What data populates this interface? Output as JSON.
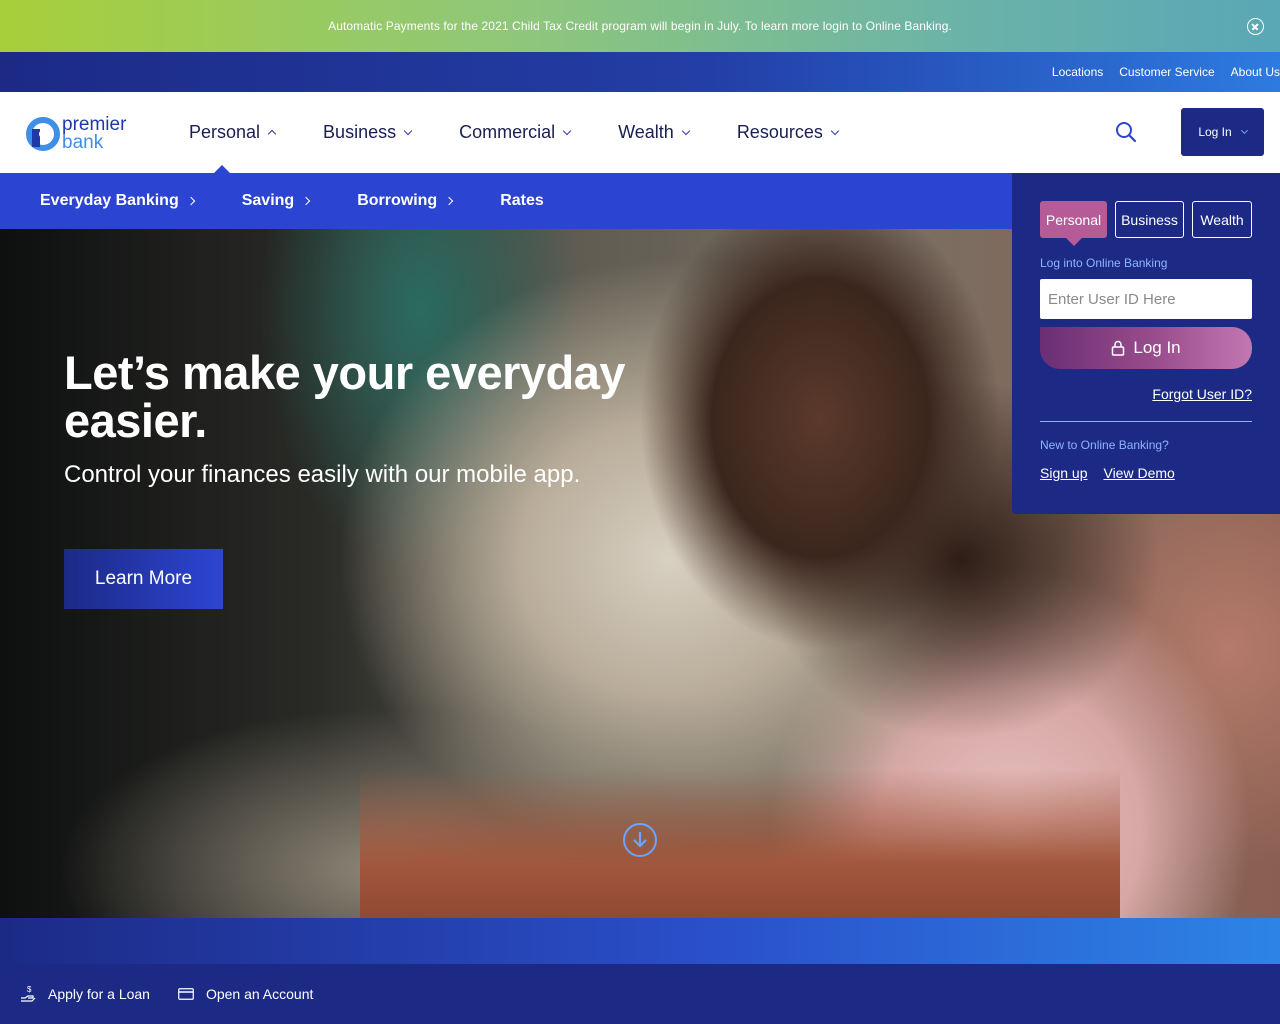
{
  "announcement": {
    "text": "Automatic Payments for the 2021 Child Tax Credit program will begin in July. To learn more login to Online Banking.",
    "close_icon": "close-circle-icon"
  },
  "utility_nav": [
    "Locations",
    "Customer Service",
    "About Us"
  ],
  "logo": {
    "line1": "premier",
    "line2": "bank"
  },
  "main_nav": [
    {
      "label": "Personal",
      "active": true
    },
    {
      "label": "Business"
    },
    {
      "label": "Commercial"
    },
    {
      "label": "Wealth"
    },
    {
      "label": "Resources"
    }
  ],
  "header": {
    "search_icon": "search-icon",
    "login_label": "Log In"
  },
  "sub_nav": [
    {
      "label": "Everyday Banking",
      "has_chevron": true
    },
    {
      "label": "Saving",
      "has_chevron": true
    },
    {
      "label": "Borrowing",
      "has_chevron": true
    },
    {
      "label": "Rates",
      "has_chevron": false
    }
  ],
  "hero": {
    "title": "Let’s make your everyday easier.",
    "subtitle": "Control your finances easily with our mobile app.",
    "cta_label": "Learn More"
  },
  "login_panel": {
    "tabs": [
      "Personal",
      "Business",
      "Wealth"
    ],
    "active_tab": "Personal",
    "label": "Log into Online Banking",
    "user_placeholder": "Enter User ID Here",
    "user_value": "",
    "submit_label": "Log In",
    "forgot_label": "Forgot User ID?",
    "new_label": "New to Online Banking?",
    "signup_label": "Sign up",
    "demo_label": "View Demo"
  },
  "quick_links": [
    {
      "label": "Apply for a Loan",
      "icon": "loan-hand-icon"
    },
    {
      "label": "Open an Account",
      "icon": "card-icon"
    }
  ],
  "colors": {
    "navy": "#1c2a86",
    "royal_blue": "#2b44d1",
    "accent_pink": "#b55c98",
    "light_blue": "#8fb4ff",
    "lime": "#a8cf3a"
  }
}
